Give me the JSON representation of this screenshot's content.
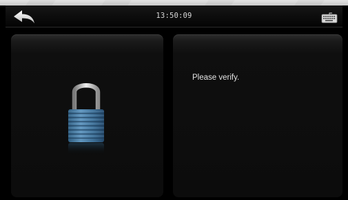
{
  "status_bar": {
    "time": "13:50:09",
    "back_icon": "back-arrow-icon",
    "keyboard_icon": "keyboard-icon"
  },
  "lock_panel": {
    "icon": "padlock-icon"
  },
  "message_panel": {
    "message": "Please verify."
  },
  "colors": {
    "background": "#000000",
    "text": "#e2e2e2",
    "lock_body": "#4a7fa6",
    "lock_shackle": "#bfbfbf"
  }
}
